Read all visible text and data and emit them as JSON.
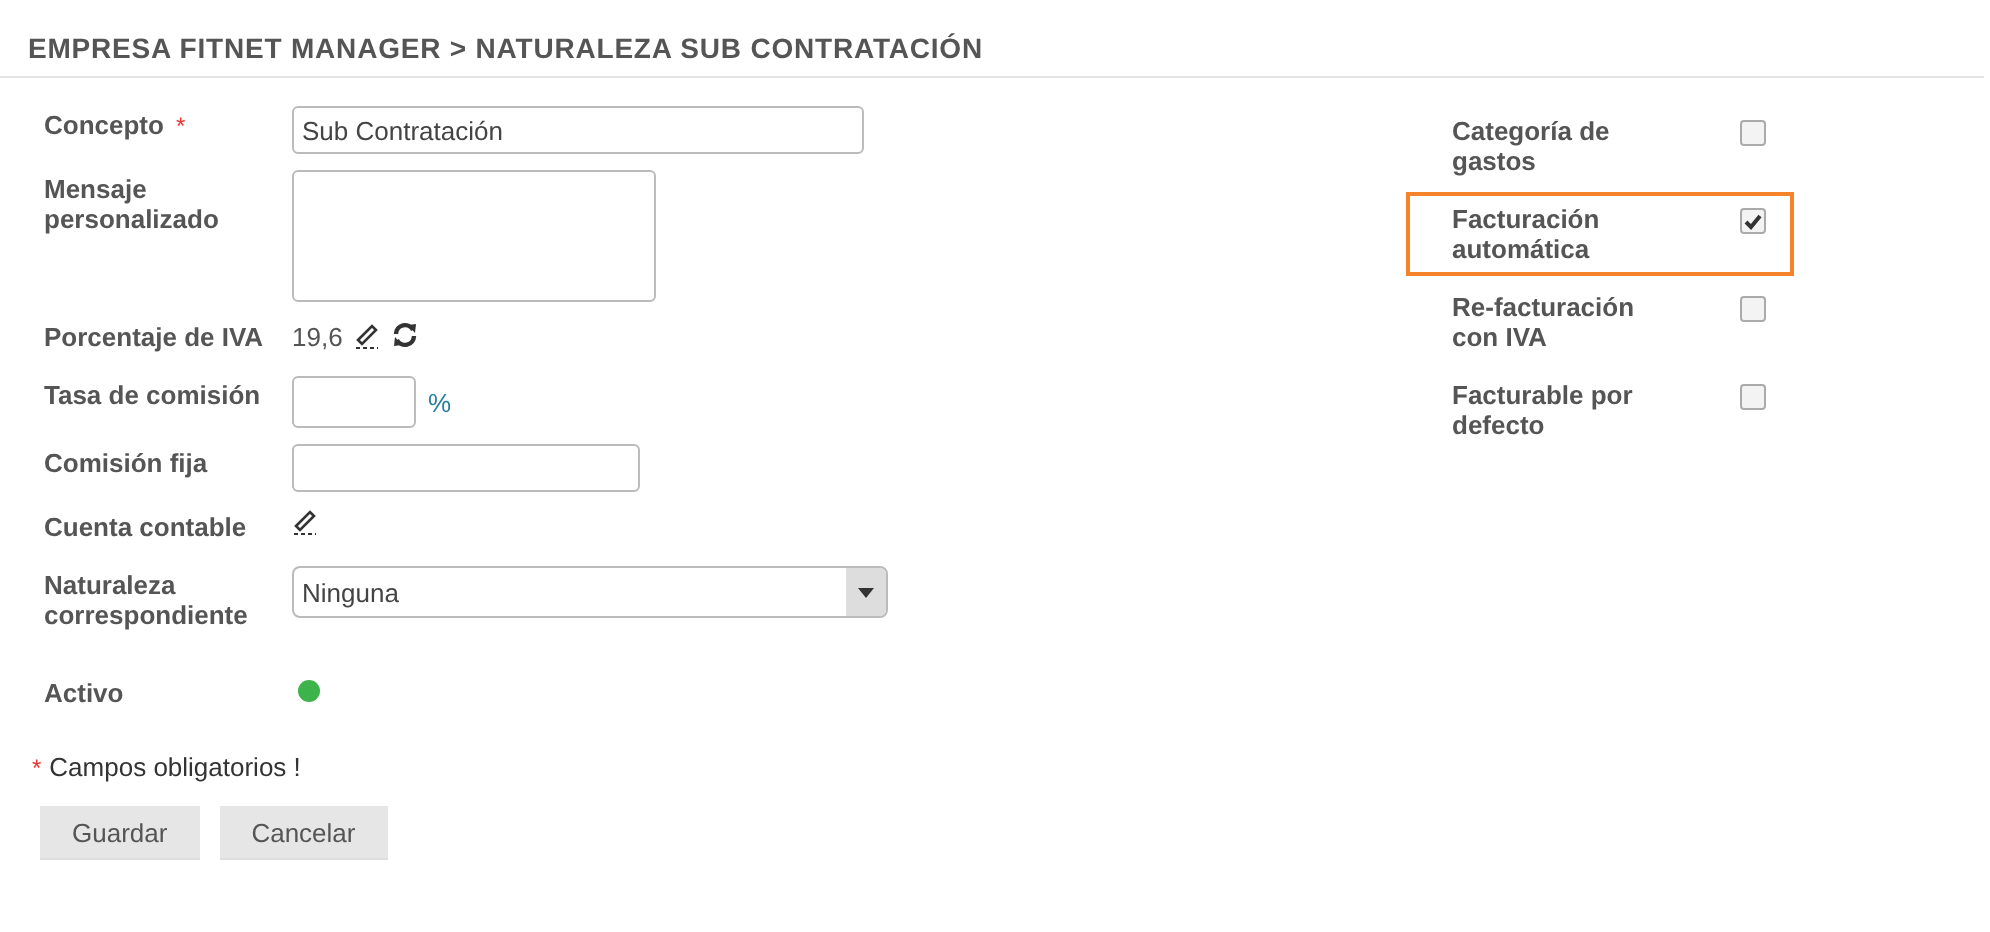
{
  "breadcrumb": "EMPRESA FITNET MANAGER > NATURALEZA SUB CONTRATACIÓN",
  "fields": [
    {
      "kind": "text",
      "label": "Concepto",
      "required": true,
      "value": "Sub Contratación"
    },
    {
      "kind": "textarea",
      "label": "Mensaje personalizado",
      "required": false
    },
    {
      "kind": "readonly",
      "label": "Porcentaje de IVA",
      "required": false,
      "value": "19,6"
    },
    {
      "kind": "percent",
      "label": "Tasa de comisión",
      "required": false,
      "suffix": "%"
    },
    {
      "kind": "amount",
      "label": "Comisión fija",
      "required": false
    },
    {
      "kind": "edit",
      "label": "Cuenta contable",
      "required": false
    },
    {
      "kind": "select",
      "label": "Naturaleza correspondiente",
      "required": false,
      "value": "Ninguna"
    },
    {
      "kind": "status",
      "label": "Activo",
      "required": false,
      "active": true
    }
  ],
  "options": [
    {
      "label": "Categoría de gastos",
      "checked": false,
      "highlighted": false
    },
    {
      "label": "Facturación automática",
      "checked": true,
      "highlighted": true
    },
    {
      "label": "Re-facturación con IVA",
      "checked": false,
      "highlighted": false
    },
    {
      "label": "Facturable por defecto",
      "checked": false,
      "highlighted": false
    }
  ],
  "required_note": {
    "mark": "*",
    "text": "Campos obligatorios !"
  },
  "buttons": [
    "Guardar",
    "Cancelar"
  ]
}
